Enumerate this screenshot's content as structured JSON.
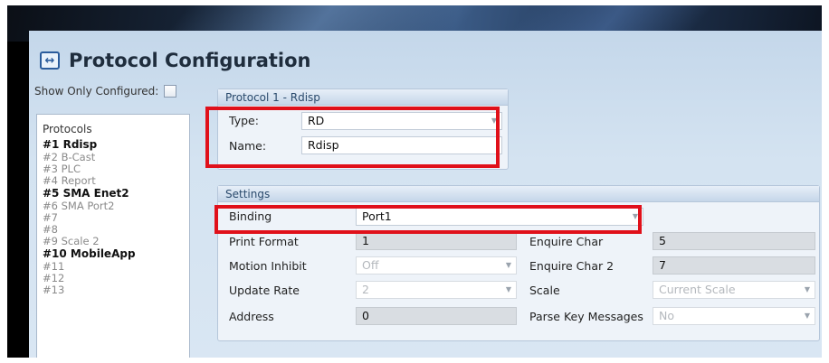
{
  "page": {
    "title": "Protocol Configuration",
    "icon": "arrows-horizontal-icon"
  },
  "filter": {
    "show_only_configured_label": "Show Only Configured:",
    "checked": false
  },
  "protocols": {
    "header": "Protocols",
    "items": [
      {
        "label": "#1 Rdisp",
        "configured": true
      },
      {
        "label": "#2 B-Cast",
        "configured": false
      },
      {
        "label": "#3 PLC",
        "configured": false
      },
      {
        "label": "#4 Report",
        "configured": false
      },
      {
        "label": "#5 SMA Enet2",
        "configured": true
      },
      {
        "label": "#6 SMA Port2",
        "configured": false
      },
      {
        "label": "#7",
        "configured": false
      },
      {
        "label": "#8",
        "configured": false
      },
      {
        "label": "#9 Scale 2",
        "configured": false
      },
      {
        "label": "#10 MobileApp",
        "configured": true
      },
      {
        "label": "#11",
        "configured": false
      },
      {
        "label": "#12",
        "configured": false
      },
      {
        "label": "#13",
        "configured": false
      }
    ]
  },
  "protocol_group": {
    "header": "Protocol 1 - Rdisp",
    "type_label": "Type:",
    "type_value": "RD",
    "name_label": "Name:",
    "name_value": "Rdisp"
  },
  "settings": {
    "header": "Settings",
    "binding_label": "Binding",
    "binding_value": "Port1",
    "print_format_label": "Print Format",
    "print_format_value": "1",
    "motion_inhibit_label": "Motion Inhibit",
    "motion_inhibit_value": "Off",
    "update_rate_label": "Update Rate",
    "update_rate_value": "2",
    "address_label": "Address",
    "address_value": "0",
    "enquire_char_label": "Enquire Char",
    "enquire_char_value": "5",
    "enquire_char2_label": "Enquire Char 2",
    "enquire_char2_value": "7",
    "scale_label": "Scale",
    "scale_value": "Current Scale",
    "parse_key_label": "Parse Key Messages",
    "parse_key_value": "No"
  },
  "colors": {
    "highlight": "#e0101a",
    "title_blue": "#2b5c9c"
  }
}
